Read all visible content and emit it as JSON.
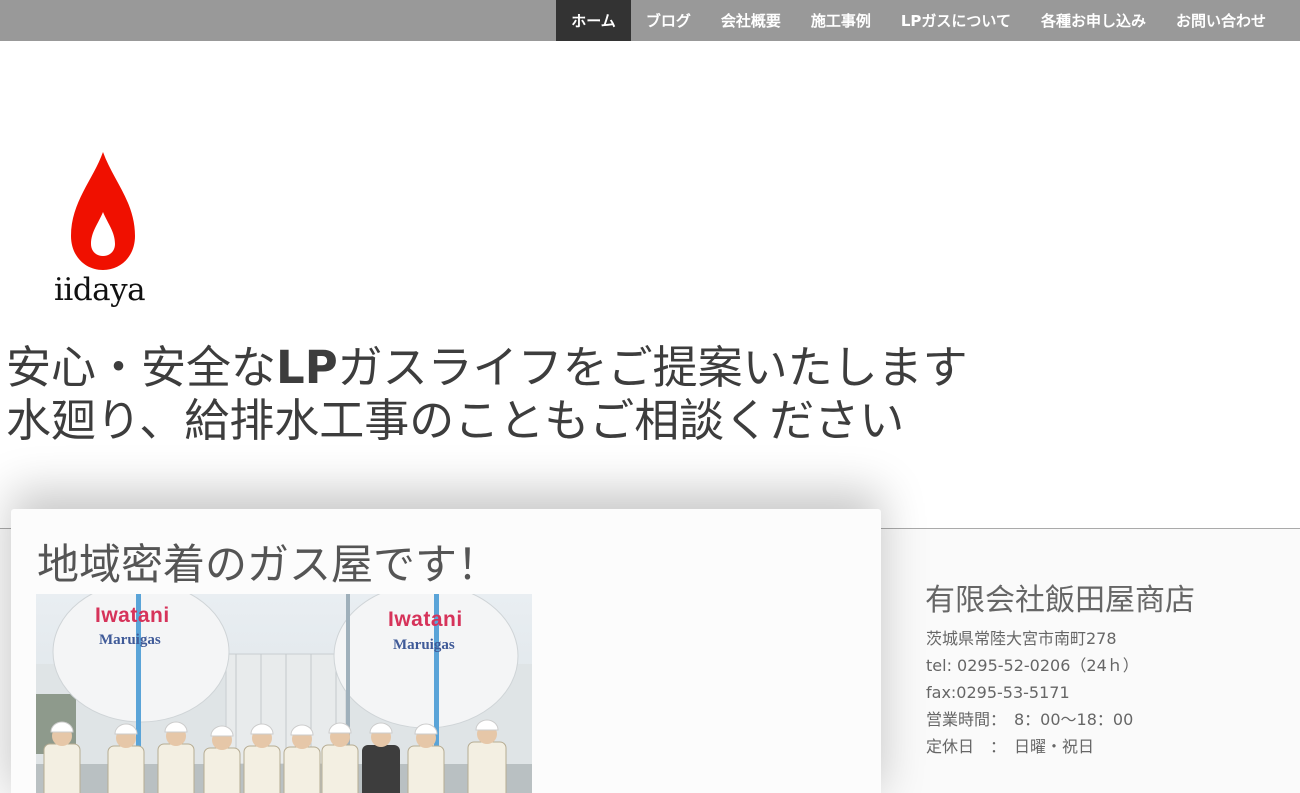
{
  "nav": {
    "items": [
      {
        "label": "ホーム",
        "active": true
      },
      {
        "label": "ブログ"
      },
      {
        "label": "会社概要"
      },
      {
        "label": "施工事例"
      },
      {
        "label": "LPガスについて"
      },
      {
        "label": "各種お申し込み"
      },
      {
        "label": "お問い合わせ"
      }
    ]
  },
  "logo": {
    "text": "iidaya",
    "color": "#f01000"
  },
  "tagline": {
    "line1_pre": "安心・安全な",
    "line1_bold": "LP",
    "line1_post": "ガスライフをご提案いたします",
    "line2": "水廻り、給排水工事のこともご相談ください"
  },
  "main": {
    "title": "地域密着のガス屋です！",
    "photo": {
      "tank_left_brand": "Iwatani",
      "tank_left_sub": "Maruigas",
      "tank_right_brand": "Iwatani",
      "tank_right_sub": "Maruigas"
    }
  },
  "company": {
    "name": "有限会社飯田屋商店",
    "address": "茨城県常陸大宮市南町278",
    "tel": "tel: 0295-52-0206（24ｈ）",
    "fax": "fax:0295-53-5171",
    "hours": "営業時間：　8：00〜18：00",
    "closed": "定休日　：　日曜・祝日"
  }
}
